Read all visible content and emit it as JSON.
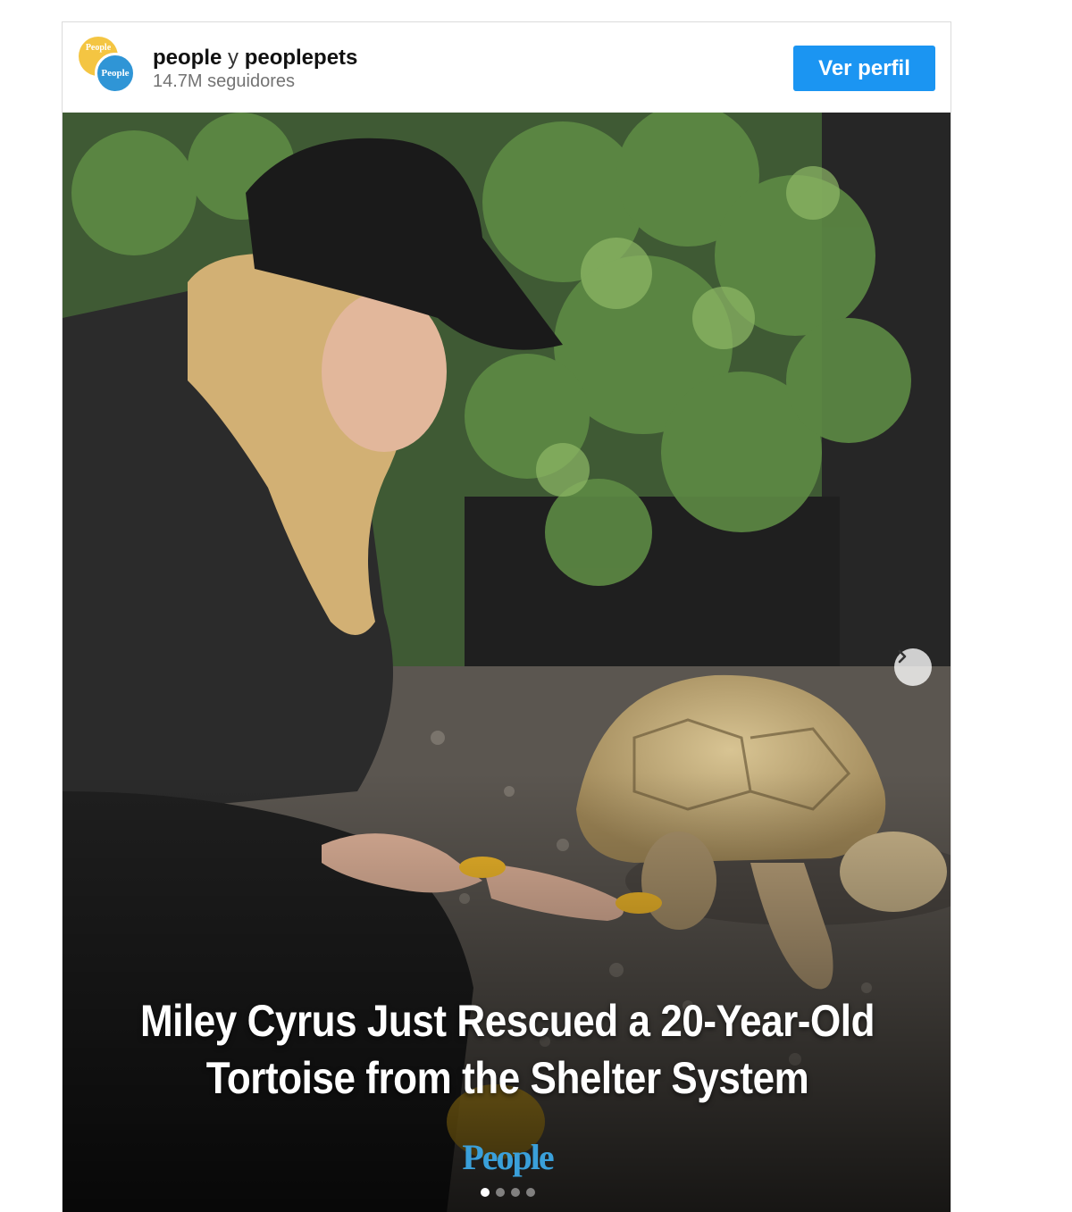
{
  "account": {
    "name_primary": "people",
    "separator": "y",
    "name_secondary": "peoplepets",
    "followers": "14.7M seguidores",
    "avatar_1_text": "People",
    "avatar_2_text": "People"
  },
  "actions": {
    "view_profile": "Ver perfil"
  },
  "post": {
    "headline_line1": "Miley Cyrus Just Rescued a 20-Year-Old",
    "headline_line2": "Tortoise from the Shelter System",
    "brand_logo": "People",
    "carousel": {
      "total": 4,
      "active_index": 0
    },
    "next_icon": "chevron-right-icon"
  },
  "colors": {
    "button": "#1b95f2",
    "brand_blue": "#3aa0da",
    "avatar_yellow": "#f4c542",
    "avatar_blue": "#2f95d6"
  }
}
